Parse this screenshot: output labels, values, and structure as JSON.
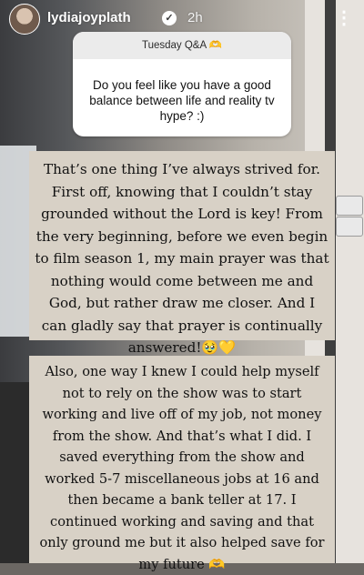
{
  "header": {
    "username": "lydiajoyplath",
    "verified_mark": "✓",
    "time": "2h",
    "more_label": "⋮"
  },
  "question_box": {
    "title": "Tuesday Q&A 🫶",
    "question": "Do you feel like you have a good balance between life and reality tv hype? :)"
  },
  "answer": {
    "paragraph_1": "That’s one thing I’ve always strived for. First off, knowing that I couldn’t stay grounded without the Lord is key! From the very beginning, before we even begin to film season 1, my main prayer was that nothing would come between me and God, but rather draw me closer. And I can gladly say that prayer is continually answered!🥹💛",
    "paragraph_2": "Also, one way I knew I could help myself not to rely on the show was to start working and live off of my job, not money from the show. And that’s what I did. I saved everything from the show and worked 5-7 miscellaneous jobs at 16 and then became a bank teller at 17. I continued working and saving and that only ground me but it also helped save for my future 🫶"
  },
  "icons": {
    "avatar": "profile-avatar",
    "verified": "verified-badge-icon",
    "more": "more-options-icon"
  }
}
